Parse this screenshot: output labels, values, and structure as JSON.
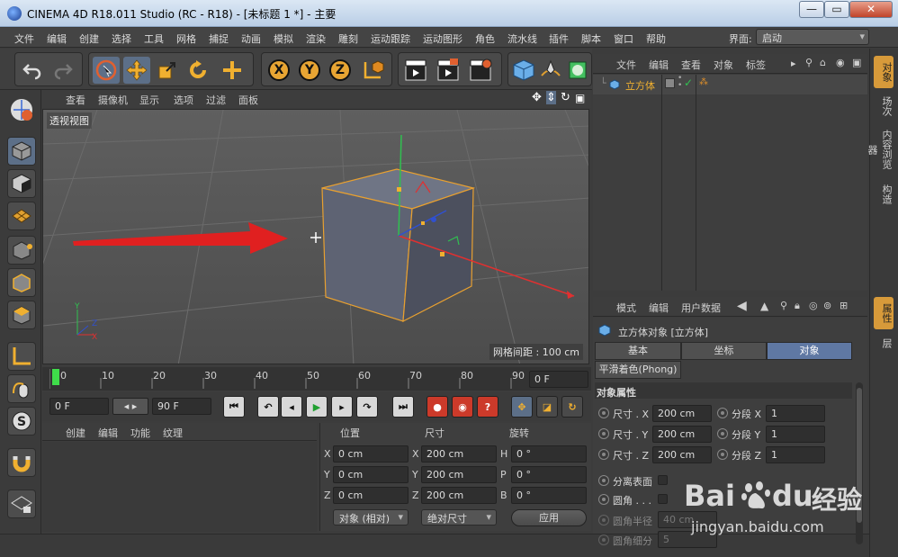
{
  "window": {
    "title": "CINEMA 4D R18.011 Studio (RC - R18) - [未标题 1 *] - 主要",
    "minimize": "—",
    "maximize": "▭",
    "close": "✕"
  },
  "menubar": {
    "items": [
      "文件",
      "编辑",
      "创建",
      "选择",
      "工具",
      "网格",
      "捕捉",
      "动画",
      "模拟",
      "渲染",
      "雕刻",
      "运动跟踪",
      "运动图形",
      "角色",
      "流水线",
      "插件",
      "脚本",
      "窗口",
      "帮助"
    ],
    "layout_label": "界面:",
    "layout_value": "启动"
  },
  "viewport": {
    "menu": [
      "查看",
      "摄像机",
      "显示",
      "选项",
      "过滤",
      "面板"
    ],
    "label": "透视视图",
    "grid_spacing": "网格间距 : 100 cm",
    "axis_x": "X",
    "axis_y": "Y",
    "axis_z": "Z"
  },
  "timeline": {
    "ticks": [
      "0",
      "10",
      "20",
      "30",
      "40",
      "50",
      "60",
      "70",
      "80",
      "90"
    ],
    "current_frame": "0 F",
    "start_frame": "0 F",
    "end_frame": "90 F",
    "progress": 0
  },
  "materials": {
    "menu": [
      "创建",
      "编辑",
      "功能",
      "纹理"
    ]
  },
  "coords": {
    "headers": [
      "位置",
      "尺寸",
      "旋转"
    ],
    "pos": [
      {
        "axis": "X",
        "value": "0 cm"
      },
      {
        "axis": "Y",
        "value": "0 cm"
      },
      {
        "axis": "Z",
        "value": "0 cm"
      }
    ],
    "size": [
      {
        "axis": "X",
        "value": "200 cm"
      },
      {
        "axis": "Y",
        "value": "200 cm"
      },
      {
        "axis": "Z",
        "value": "200 cm"
      }
    ],
    "rot": [
      {
        "axis": "H",
        "value": "0 °"
      },
      {
        "axis": "P",
        "value": "0 °"
      },
      {
        "axis": "B",
        "value": "0 °"
      }
    ],
    "mode_object": "对象 (相对)",
    "mode_size": "绝对尺寸",
    "apply": "应用"
  },
  "object_manager": {
    "menu": [
      "文件",
      "编辑",
      "查看",
      "对象",
      "标签"
    ],
    "object_name": "立方体"
  },
  "attributes": {
    "menu": [
      "模式",
      "编辑",
      "用户数据"
    ],
    "object_title": "立方体对象 [立方体]",
    "tabs": [
      "基本",
      "坐标",
      "对象"
    ],
    "active_tab": "对象",
    "phong_tab": "平滑着色(Phong)",
    "section": "对象属性",
    "size_x_label": "尺寸 . X",
    "size_y_label": "尺寸 . Y",
    "size_z_label": "尺寸 . Z",
    "size_x": "200 cm",
    "size_y": "200 cm",
    "size_z": "200 cm",
    "seg_x_label": "分段 X",
    "seg_y_label": "分段 Y",
    "seg_z_label": "分段 Z",
    "seg_x": "1",
    "seg_y": "1",
    "seg_z": "1",
    "separate_surfaces": "分离表面",
    "fillet": "圆角 . . .",
    "fillet_radius_label": "圆角半径",
    "fillet_radius": "40 cm",
    "fillet_subdiv_label": "圆角细分",
    "fillet_subdiv": "5"
  },
  "side_tabs": {
    "top": [
      "对象",
      "场次",
      "内容浏览器",
      "构造"
    ],
    "bottom": [
      "属性",
      "层"
    ]
  },
  "watermark": {
    "brand": "Bai",
    "brand2": "du",
    "cn": "经验",
    "url": "jingyan.baidu.com"
  },
  "colors": {
    "accent": "#d79a3a",
    "selection": "#5f78a3",
    "arrow": "#e02020"
  }
}
